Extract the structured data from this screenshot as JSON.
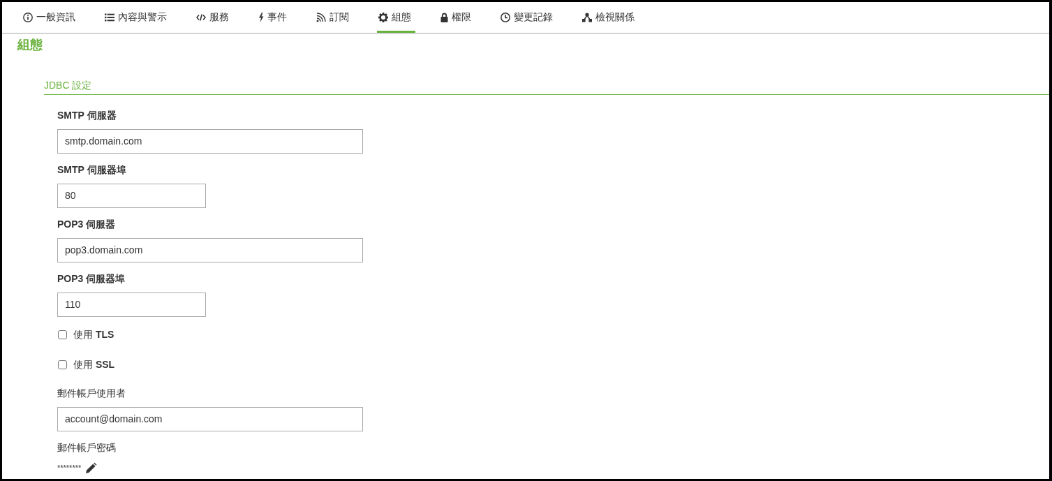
{
  "tabs": [
    {
      "label": "一般資訊",
      "selected": false
    },
    {
      "label": "內容與警示",
      "selected": false
    },
    {
      "label": "服務",
      "selected": false
    },
    {
      "label": "事件",
      "selected": false
    },
    {
      "label": "訂閱",
      "selected": false
    },
    {
      "label": "組態",
      "selected": true
    },
    {
      "label": "權限",
      "selected": false
    },
    {
      "label": "變更記錄",
      "selected": false
    },
    {
      "label": "檢視關係",
      "selected": false
    }
  ],
  "page_title": "組態",
  "section": {
    "title": "JDBC 設定",
    "fields": [
      {
        "kind": "text",
        "label": "SMTP 伺服器",
        "label_bold": true,
        "value": "smtp.domain.com"
      },
      {
        "kind": "number",
        "label": "SMTP 伺服器埠",
        "label_bold": true,
        "value": "80"
      },
      {
        "kind": "text",
        "label": "POP3 伺服器",
        "label_bold": true,
        "value": "pop3.domain.com"
      },
      {
        "kind": "number",
        "label": "POP3 伺服器埠",
        "label_bold": true,
        "value": "110"
      },
      {
        "kind": "checkbox",
        "label": "使用 **TLS**",
        "checked": false
      },
      {
        "kind": "checkbox",
        "label": "使用 **SSL**",
        "checked": false
      },
      {
        "kind": "text",
        "label": "郵件帳戶使用者",
        "label_bold": false,
        "value": "account@domain.com"
      },
      {
        "kind": "password",
        "label": "郵件帳戶密碼",
        "label_bold": false,
        "value": "********"
      }
    ]
  }
}
